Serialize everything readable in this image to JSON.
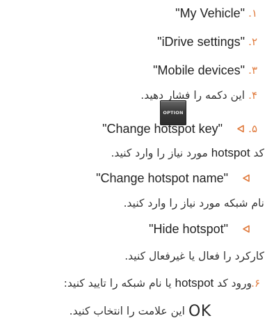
{
  "steps": [
    {
      "num": "۱.",
      "text": "\"My Vehicle\""
    },
    {
      "num": "۲.",
      "text": "\"iDrive settings\""
    },
    {
      "num": "۳.",
      "text": "\"Mobile devices\""
    },
    {
      "num": "۴.",
      "text": "این دکمه را فشار دهید.",
      "button_label": "OPTION"
    },
    {
      "num": "۵.",
      "text": "\"Change hotspot key\""
    },
    {
      "num": "۶.",
      "text_pre": "ورود کد ",
      "text_keyword": "hotspot",
      "text_post": " یا نام شبکه را تایید کنید:"
    }
  ],
  "substeps": [
    {
      "text": "\"Change hotspot key\"",
      "desc_pre": "کد ",
      "desc_keyword": "hotspot",
      "desc_post": " مورد نیاز را وارد کنید."
    },
    {
      "text": "\"Change hotspot name\"",
      "desc": "نام شبکه مورد نیاز را وارد کنید."
    },
    {
      "text": "\"Hide hotspot\"",
      "desc": "کارکرد را فعال یا غیرفعال کنید."
    }
  ],
  "final": {
    "symbol": "OK",
    "text": "این علامت را انتخاب کنید."
  },
  "colors": {
    "step_number": "#e07a3c",
    "triangle": "#e07a3c",
    "text": "#222222"
  },
  "icons": {
    "option_button": "option-button-icon",
    "substep_marker": "triangle-left-icon",
    "ok_symbol": "ok-icon"
  }
}
